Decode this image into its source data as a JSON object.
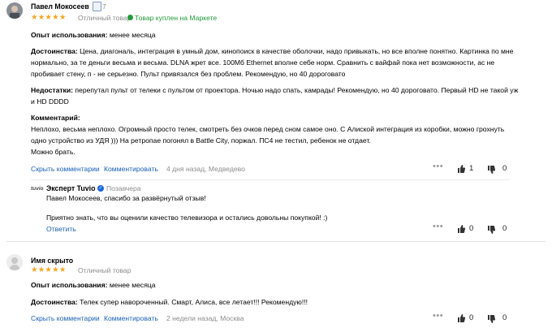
{
  "review1": {
    "author": "Павел Мокосеев",
    "badge_count": "7",
    "stars": "★★★★★",
    "rating_text": "Отличный товар",
    "market_text": "Товар куплен на Маркете",
    "experience_label": "Опыт использования:",
    "experience_value": "менее месяца",
    "pros_label": "Достоинства:",
    "pros_lines": [
      "Цена, диагональ, интеграция в умный дом, кинопоиск в качестве оболочки, надо привыкать, но все вполне понятно. Картинка по мне",
      "нормально, за те деньги весьма и весьма. DLNA жрет все. 100Мб Ethernet вполне себе норм. Сравнить с вайфай пока нет возможности, ас не",
      "пробивает стену, п - не серьезно. Пульт привязался без проблем. Рекомендую, но 40 дороговато"
    ],
    "cons_label": "Недостатки:",
    "cons_lines": [
      "перепутал пульт от телеки с пультом от проектора. Ночью надо спать, камрады! Рекомендую, но 40 дороговато. Первый HD не такой уж",
      "и HD DDDD"
    ],
    "comment_label": "Комментарий:",
    "comment_lines": [
      "Неплохо, весьма неплохо. Огромный просто телек, смотреть без очков перед сном самое оно. С Алиской интеграция из коробки, можно грохнуть",
      "одно устройство из УДЯ ))) На ретропае погонял в Battle City, поржал. ПС4 не тестил, ребенок не отдает.",
      "Можно брать."
    ],
    "show_comments": "Скрыть комментарии",
    "comment_action": "Комментировать",
    "date": "4 дня назад, Медведево",
    "likes": "1",
    "dislikes": "0"
  },
  "answer": {
    "logo": "tuvio",
    "author": "Эксперт Tuvio",
    "verified_mark": "✓",
    "role": "Позавчера",
    "line1": "Павел Мокосеев, спасибо за развёрнутый отзыв!",
    "line2": "Приятно знать, что вы оценили качество телевизора и остались довольны покупкой! :)",
    "reply": "Ответить",
    "likes": "0",
    "dislikes": "0"
  },
  "review2": {
    "author": "Имя скрыто",
    "stars": "★★★★★",
    "rating_text": "Отличный товар",
    "experience_label": "Опыт использования:",
    "experience_value": "менее месяца",
    "pros_label": "Достоинства:",
    "pros_value": "Телек супер навороченный. Смарт, Алиса, все летает!!! Рекомендую!!!",
    "show_comments": "Скрыть комментарии",
    "comment_action": "Комментировать",
    "date": "2 недели назад, Москва",
    "likes": "0",
    "dislikes": "0"
  },
  "colors": {
    "link": "#1a5fb4",
    "star": "#f5a623",
    "market_green": "#239b3a",
    "muted": "#8c8c8c"
  }
}
